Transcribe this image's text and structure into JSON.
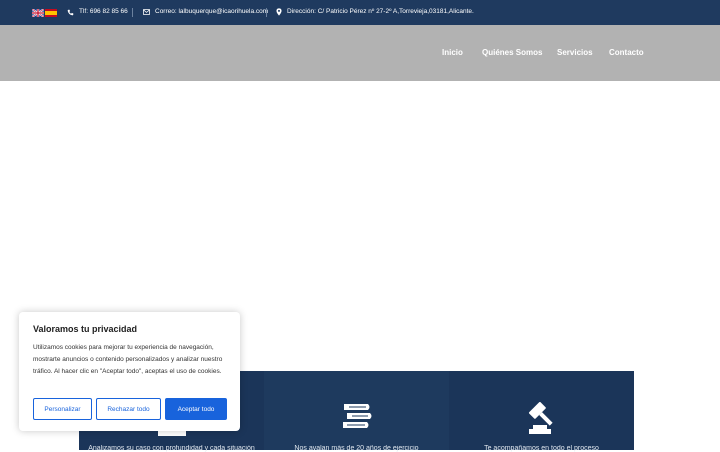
{
  "topbar": {
    "phone": "Tlf: 696 82 85 66",
    "email": "Correo: lalbuquerque@icaorihuela.com",
    "address": "Dirección: C/ Patricio Pérez nº 27-2º A,Torrevieja,03181,Alicante."
  },
  "nav": {
    "items": [
      "Inicio",
      "Quiénes Somos",
      "Servicios",
      "Contacto"
    ]
  },
  "features": [
    {
      "icon": "document-pen-icon",
      "text": "Analizamos su caso con profundidad y cada situación"
    },
    {
      "icon": "stacked-books-icon",
      "text": "Nos avalan más de 20 años de ejercicio"
    },
    {
      "icon": "gavel-icon",
      "text": "Te acompañamos en todo el proceso"
    }
  ],
  "cookie": {
    "title": "Valoramos tu privacidad",
    "text": "Utilizamos cookies para mejorar tu experiencia de navegación, mostrarte anuncios o contenido personalizados y analizar nuestro tráfico. Al hacer clic en \"Aceptar todo\", aceptas el uso de cookies.",
    "customize": "Personalizar",
    "reject": "Rechazar todo",
    "accept": "Aceptar todo"
  },
  "colors": {
    "topbar": "#1f3a5f",
    "navbar": "#b2b2b2",
    "feature_bg_1": "#1b3559",
    "feature_bg_2": "#1e3a5e",
    "accent": "#1863dc"
  }
}
